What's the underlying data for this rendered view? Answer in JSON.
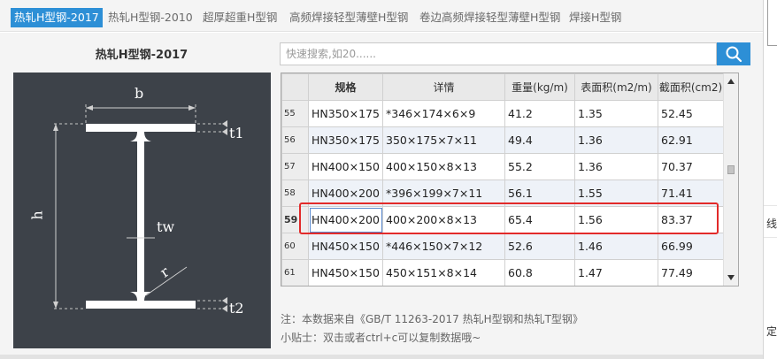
{
  "tabs": [
    {
      "label": "热轧H型钢-2017",
      "active": true
    },
    {
      "label": "热轧H型钢-2010",
      "active": false
    },
    {
      "label": "超厚超重H型钢",
      "active": false
    },
    {
      "label": "高频焊接轻型薄壁H型钢",
      "active": false
    },
    {
      "label": "卷边高频焊接轻型薄壁H型钢",
      "active": false
    },
    {
      "label": "焊接H型钢",
      "active": false
    }
  ],
  "left_panel": {
    "title": "热轧H型钢-2017",
    "diagram_labels": {
      "b": "b",
      "h": "h",
      "t1": "t1",
      "tw": "tw",
      "r": "r",
      "t2": "t2"
    }
  },
  "search": {
    "placeholder": "快速搜索,如20......",
    "value": "",
    "icon": "search-icon"
  },
  "table": {
    "columns": [
      "规格",
      "详情",
      "重量(kg/m)",
      "表面积(m2/m)",
      "截面积(cm2)"
    ],
    "selected_row": "59",
    "rows": [
      {
        "num": "55",
        "spec": "HN350×175",
        "detail": "*346×174×6×9",
        "weight": "41.2",
        "surface": "1.35",
        "section": "52.45"
      },
      {
        "num": "56",
        "spec": "HN350×175",
        "detail": "350×175×7×11",
        "weight": "49.4",
        "surface": "1.36",
        "section": "62.91"
      },
      {
        "num": "57",
        "spec": "HN400×150",
        "detail": "400×150×8×13",
        "weight": "55.2",
        "surface": "1.36",
        "section": "70.37"
      },
      {
        "num": "58",
        "spec": "HN400×200",
        "detail": "*396×199×7×11",
        "weight": "56.1",
        "surface": "1.55",
        "section": "71.41"
      },
      {
        "num": "59",
        "spec": "HN400×200",
        "detail": "400×200×8×13",
        "weight": "65.4",
        "surface": "1.56",
        "section": "83.37"
      },
      {
        "num": "60",
        "spec": "HN450×150",
        "detail": "*446×150×7×12",
        "weight": "52.6",
        "surface": "1.46",
        "section": "66.99"
      },
      {
        "num": "61",
        "spec": "HN450×150",
        "detail": "450×151×8×14",
        "weight": "60.8",
        "surface": "1.47",
        "section": "77.49"
      }
    ]
  },
  "footer": {
    "note": "注：本数据来自《GB/T 11263-2017 热轧H型钢和热轧T型钢》",
    "tip": "小贴士：双击或者ctrl+c可以复制数据哦~"
  },
  "edge_glyphs": [
    "线",
    "定"
  ],
  "colors": {
    "accent": "#2d8fd6",
    "highlight": "#e22a2a",
    "diagram_bg": "#3d4249",
    "steel": "#ffffff"
  }
}
